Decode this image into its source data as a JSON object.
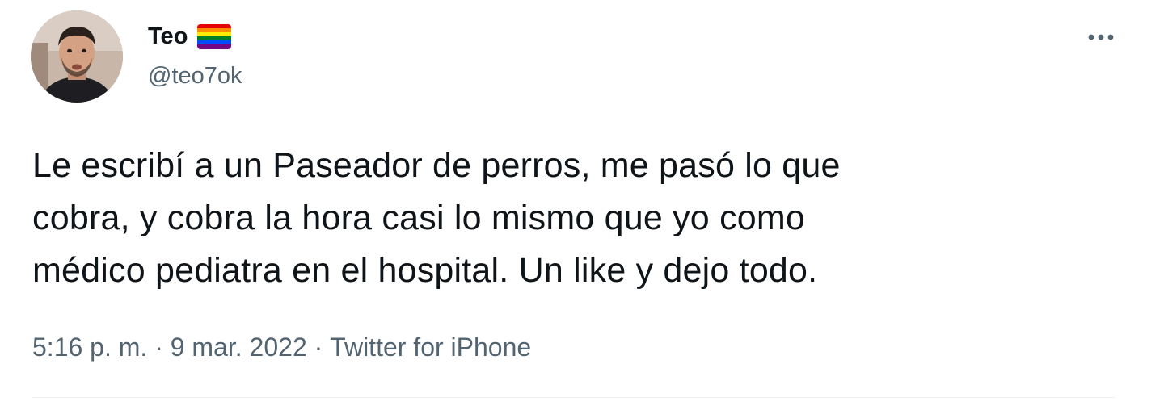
{
  "author": {
    "display_name": "Teo",
    "badge_emoji": "🏳️‍🌈",
    "handle": "@teo7ok"
  },
  "tweet": {
    "text": "Le escribí a un Paseador de perros, me pasó lo que\ncobra, y cobra la hora casi lo mismo que yo como\nmédico pediatra en el hospital. Un like y dejo todo.",
    "time": "5:16 p. m.",
    "separator": " · ",
    "date": "9 mar. 2022",
    "source": "Twitter for iPhone"
  },
  "icons": {
    "more": "more-horizontal-icon",
    "flag": "rainbow-flag-icon"
  },
  "colors": {
    "text": "#0f1419",
    "secondary": "#536471",
    "divider": "#eff3f4"
  }
}
